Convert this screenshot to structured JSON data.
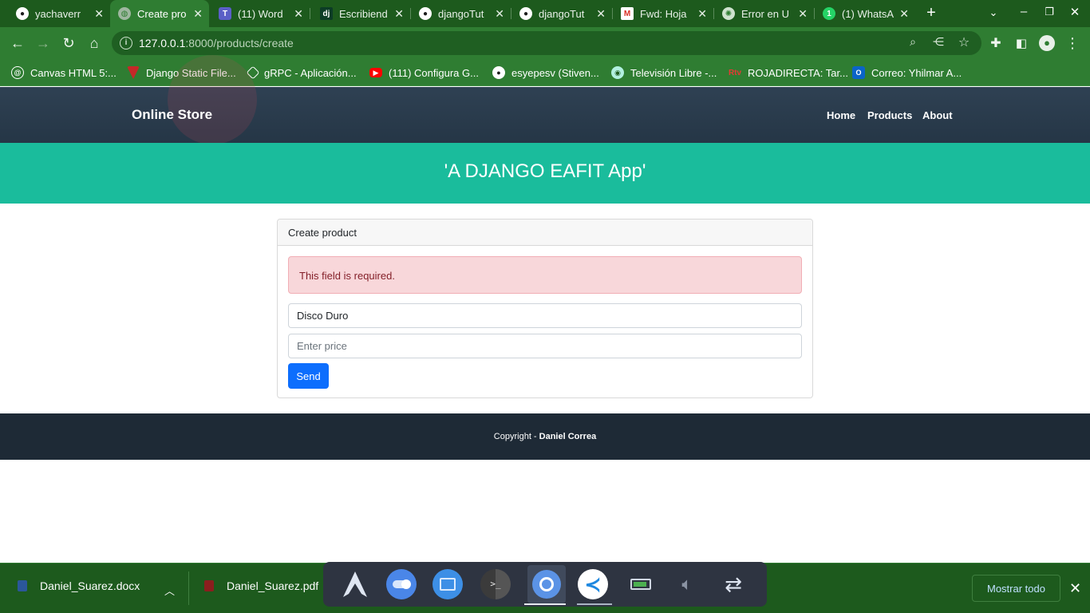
{
  "browser": {
    "tabs": [
      {
        "title": "yachaverr",
        "icon": "github-icon"
      },
      {
        "title": "Create pro",
        "icon": "globe-icon",
        "active": true
      },
      {
        "title": "(11) Word",
        "icon": "teams-icon"
      },
      {
        "title": "Escribiend",
        "icon": "django-icon"
      },
      {
        "title": "djangoTut",
        "icon": "github-icon"
      },
      {
        "title": "djangoTut",
        "icon": "github-icon"
      },
      {
        "title": "Fwd: Hoja",
        "icon": "gmail-icon"
      },
      {
        "title": "Error en U",
        "icon": "openai-icon"
      },
      {
        "title": "(1) WhatsA",
        "icon": "whatsapp-icon"
      }
    ],
    "url_host": "127.0.0.1",
    "url_path": ":8000/products/create",
    "bookmarks": [
      "Canvas HTML 5:...",
      "Django Static File...",
      "gRPC - Aplicación...",
      "(111) Configura G...",
      "esyepesv (Stiven...",
      "Televisión Libre -...",
      "ROJADIRECTA: Tar...",
      "Correo: Yhilmar A..."
    ]
  },
  "site": {
    "brand": "Online Store",
    "nav": {
      "home": "Home",
      "products": "Products",
      "about": "About"
    },
    "hero_title": "'A DJANGO EAFIT App'",
    "card_title": "Create product",
    "alert": "This field is required.",
    "name_value": "Disco Duro",
    "price_placeholder": "Enter price",
    "send_label": "Send",
    "footer_prefix": "Copyright - ",
    "footer_author": "Daniel Correa"
  },
  "downloads": {
    "files": [
      "Daniel_Suarez.docx",
      "Daniel_Suarez.pdf"
    ],
    "show_all": "Mostrar todo"
  },
  "colors": {
    "browser_dark": "#1d5a1d",
    "browser_light": "#2f7d32",
    "nav_bg": "#2c3e50",
    "hero_bg": "#1abc9c",
    "alert_bg": "#f8d7da",
    "button_bg": "#0d6efd",
    "footer_bg": "#1e2a36"
  }
}
